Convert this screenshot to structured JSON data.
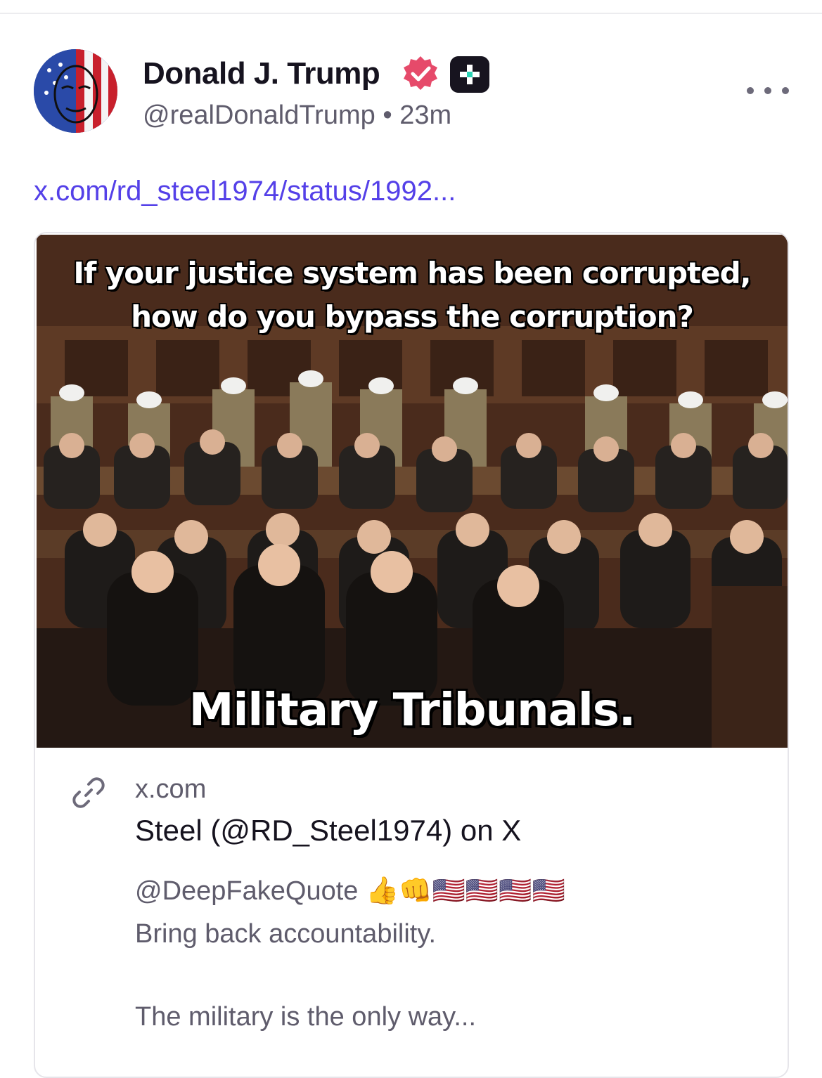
{
  "post": {
    "author_name": "Donald J. Trump",
    "handle": "@realDonaldTrump",
    "separator": "•",
    "time": "23m",
    "more_icon": "more-horizontal-icon",
    "link_text": "x.com/rd_steel1974/status/1992..."
  },
  "image": {
    "top_text_line1": "If your justice system has been corrupted,",
    "top_text_line2": "how do you bypass the corruption?",
    "bottom_text": "Military Tribunals."
  },
  "card": {
    "domain": "x.com",
    "title": "Steel (@RD_Steel1974) on X",
    "description_handle": "@DeepFakeQuote 👍👊🇺🇸🇺🇸🇺🇸🇺🇸",
    "description_line1": "Bring back accountability.",
    "description_line2": "The military is the only way..."
  },
  "colors": {
    "link": "#5440e8",
    "verified": "#e64a6a",
    "text_primary": "#16131f",
    "text_secondary": "#5f5c6c"
  }
}
